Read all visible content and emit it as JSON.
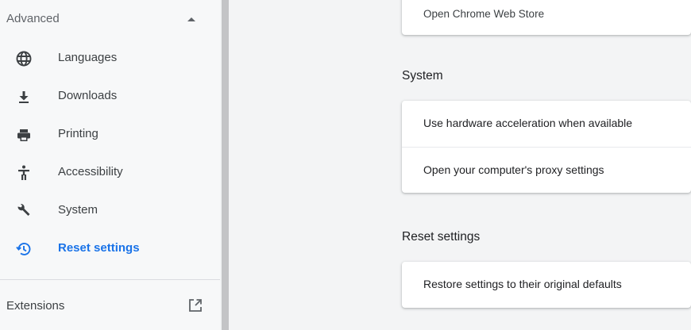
{
  "sidebar": {
    "advanced_label": "Advanced",
    "items": [
      {
        "label": "Languages",
        "icon": "globe-icon"
      },
      {
        "label": "Downloads",
        "icon": "download-icon"
      },
      {
        "label": "Printing",
        "icon": "printer-icon"
      },
      {
        "label": "Accessibility",
        "icon": "accessibility-icon"
      },
      {
        "label": "System",
        "icon": "wrench-icon"
      },
      {
        "label": "Reset settings",
        "icon": "reset-history-icon"
      }
    ],
    "active_item": "Reset settings",
    "extensions_label": "Extensions",
    "extensions_icon": "open-in-new-icon"
  },
  "main": {
    "top_card": {
      "label": "Open Chrome Web Store"
    },
    "system": {
      "title": "System",
      "rows": [
        {
          "label": "Use hardware acceleration when available"
        },
        {
          "label": "Open your computer's proxy settings"
        }
      ]
    },
    "reset": {
      "title": "Reset settings",
      "rows": [
        {
          "label": "Restore settings to their original defaults"
        }
      ]
    }
  },
  "colors": {
    "accent": "#1a73e8",
    "icon": "#3c4043",
    "sidebar_bg": "#f7f8f9",
    "main_bg": "#f3f4f5"
  }
}
